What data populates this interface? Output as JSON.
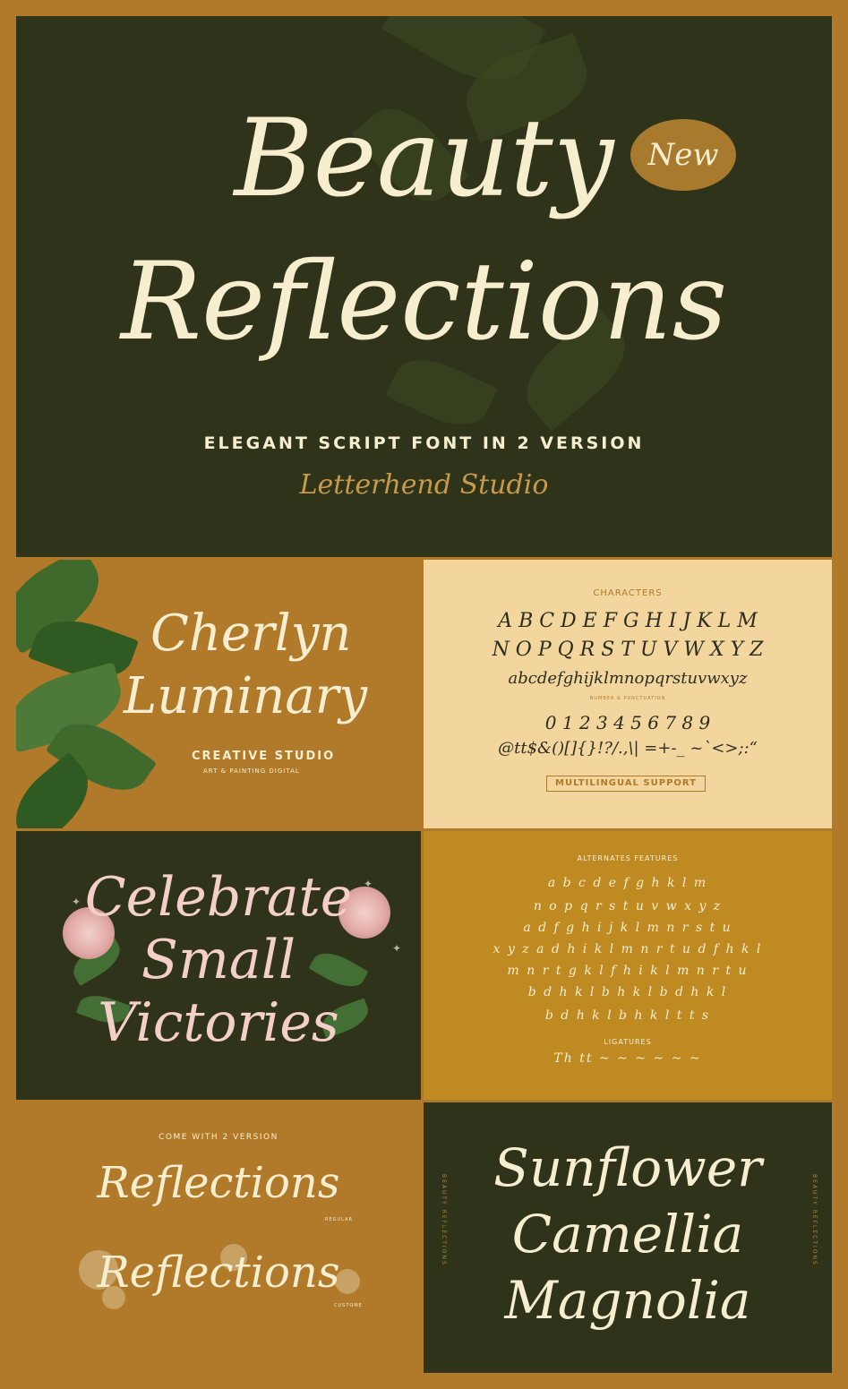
{
  "hero": {
    "title_line1": "Beauty",
    "title_line2": "Reflections",
    "badge": "New",
    "subtitle": "ELEGANT SCRIPT FONT IN 2 VERSION",
    "studio": "Letterhend Studio"
  },
  "cherlyn": {
    "line1": "Cherlyn",
    "line2": "Luminary",
    "subtitle": "CREATIVE STUDIO",
    "caption": "ART & PAINTING DIGITAL"
  },
  "characters": {
    "label": "CHARACTERS",
    "upper1": "A B C D E F G H I J K L M",
    "upper2": "N O P Q R S T U V W X Y Z",
    "lower": "abcdefghijklmnopqrstuvwxyz",
    "numbers_label": "NUMBER & PUNCTUATION",
    "numbers": "0 1 2 3 4 5 6 7 8 9",
    "punct": "@tt$&()[]{}!?/.,\\| =+-_ ~`<>;:“",
    "button": "MULTILINGUAL SUPPORT"
  },
  "celebrate": {
    "line1": "Celebrate",
    "line2": "Small",
    "line3": "Victories"
  },
  "alternates": {
    "label": "ALTERNATES FEATURES",
    "rows": [
      "a b c d e f g h k l m",
      "n o p q r s t u v w x y z",
      "a d f g h i j k l m n r s t u",
      "x y z a d h i k l m n r t u  d f h k l",
      "m n r t g k l f h i k l m n r t u",
      "b d h k l  b h k l  b d h k l",
      "b d h k l  b h k l  t t s"
    ],
    "ligatures_label": "LIGATURES",
    "ligatures": "Th tt ~ ~ ~ ~ ~ ~"
  },
  "versions": {
    "label": "COME WITH 2 VERSION",
    "word": "Reflections",
    "regular_tag": "REGULAR",
    "custom_tag": "CUSTOME"
  },
  "flowers": {
    "line1": "Sunflower",
    "line2": "Camellia",
    "line3": "Magnolia",
    "side_text": "BEAUTY REFLECTIONS"
  },
  "colors": {
    "dark_green": "#2e331a",
    "ochre": "#b07a2a",
    "cream": "#f3d59e",
    "ivory": "#f7eed0",
    "pink": "#f3cfc7"
  }
}
